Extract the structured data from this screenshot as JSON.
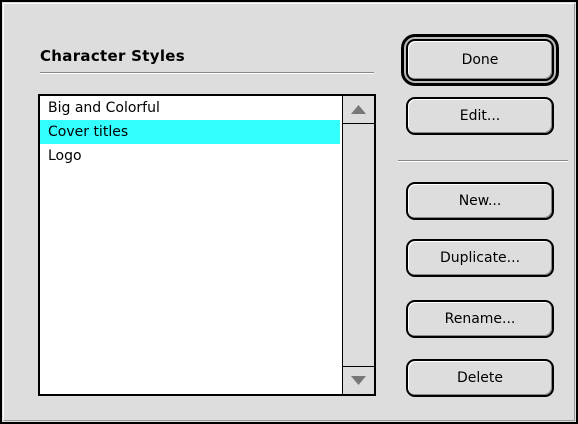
{
  "dialog": {
    "title": "Character Styles"
  },
  "styles_list": {
    "items": [
      {
        "label": "Big and Colorful",
        "selected": false
      },
      {
        "label": "Cover titles",
        "selected": true
      },
      {
        "label": "Logo",
        "selected": false
      }
    ],
    "selection_color": "#33ffff"
  },
  "buttons": {
    "done": "Done",
    "edit": "Edit...",
    "new": "New...",
    "duplicate": "Duplicate...",
    "rename": "Rename...",
    "delete": "Delete"
  },
  "icons": {
    "scroll_up": "triangle-up-icon",
    "scroll_down": "triangle-down-icon"
  }
}
